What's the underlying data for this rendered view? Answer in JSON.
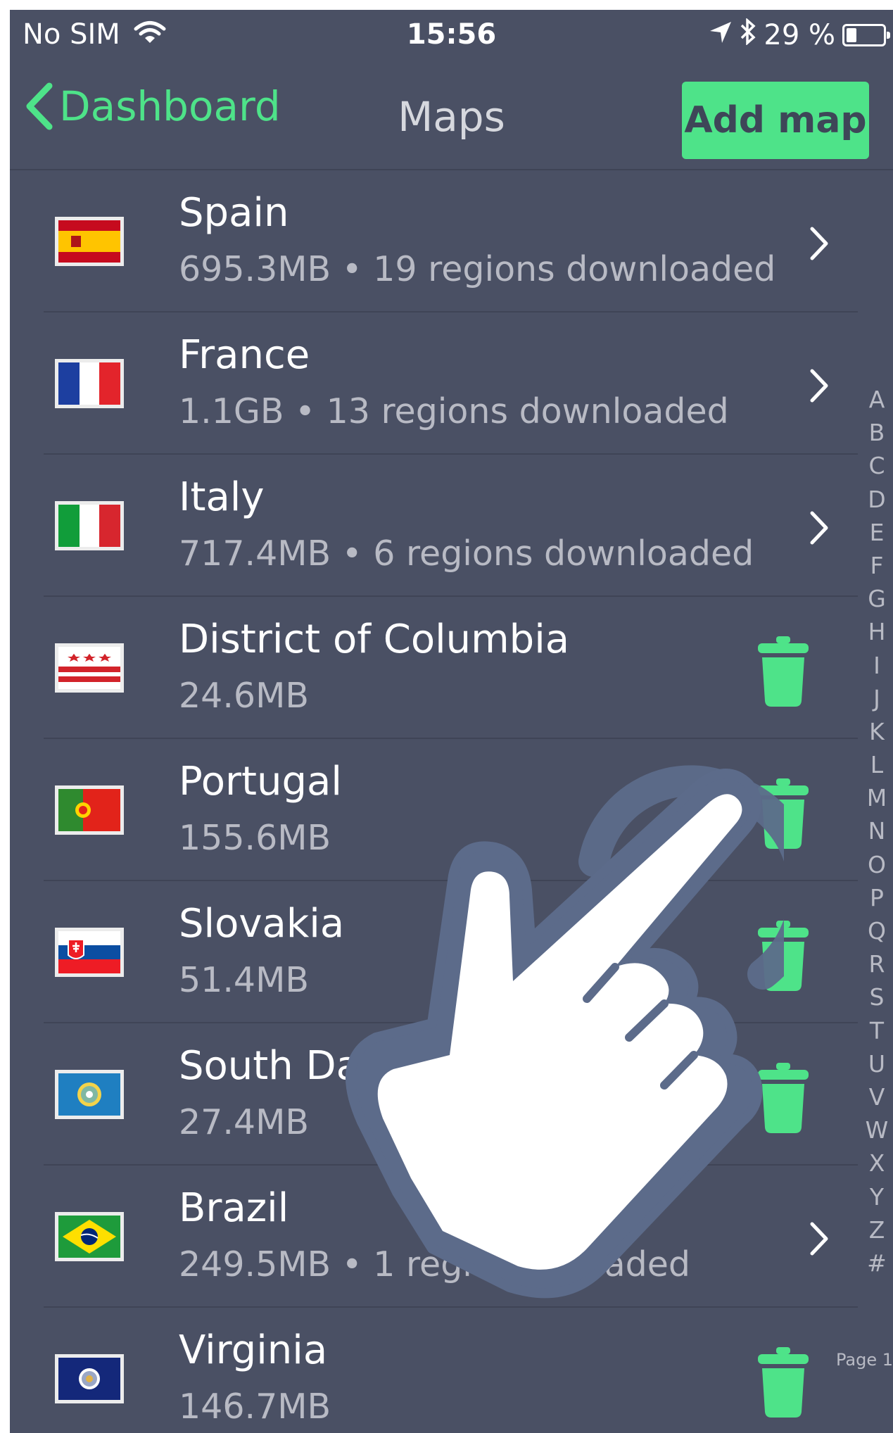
{
  "status_bar": {
    "carrier": "No SIM",
    "time": "15:56",
    "battery": "29 %",
    "battery_level": 0.29
  },
  "nav": {
    "back_label": "Dashboard",
    "title": "Maps",
    "add_label": "Add map"
  },
  "maps": [
    {
      "name": "Spain",
      "detail": "695.3MB • 19 regions downloaded",
      "action": "chevron-right",
      "flag": "spain"
    },
    {
      "name": "France",
      "detail": "1.1GB • 13 regions downloaded",
      "action": "chevron-right",
      "flag": "france"
    },
    {
      "name": "Italy",
      "detail": "717.4MB • 6 regions downloaded",
      "action": "chevron-right",
      "flag": "italy"
    },
    {
      "name": "District of Columbia",
      "detail": "24.6MB",
      "action": "trash",
      "flag": "district-of-columbia"
    },
    {
      "name": "Portugal",
      "detail": "155.6MB",
      "action": "trash",
      "flag": "portugal"
    },
    {
      "name": "Slovakia",
      "detail": "51.4MB",
      "action": "trash",
      "flag": "slovakia"
    },
    {
      "name": "South Da",
      "detail": "27.4MB",
      "action": "trash",
      "flag": "south-dakota"
    },
    {
      "name": "Brazil",
      "detail": "249.5MB • 1 regi",
      "detail_tail": "nloaded",
      "action": "chevron-right",
      "flag": "brazil"
    },
    {
      "name": "Virginia",
      "detail": "146.7MB",
      "action": "trash",
      "flag": "virginia"
    }
  ],
  "index_letters": [
    "A",
    "B",
    "C",
    "D",
    "E",
    "F",
    "G",
    "H",
    "I",
    "J",
    "K",
    "L",
    "M",
    "N",
    "O",
    "P",
    "Q",
    "R",
    "S",
    "T",
    "U",
    "V",
    "W",
    "X",
    "Y",
    "Z",
    "#"
  ],
  "page_label": "Page 1",
  "colors": {
    "background": "#4a5064",
    "accent": "#4ee389",
    "text": "#ffffff",
    "subtext": "#b8bac4"
  },
  "overlay": {
    "icon": "tap-hand-icon"
  }
}
